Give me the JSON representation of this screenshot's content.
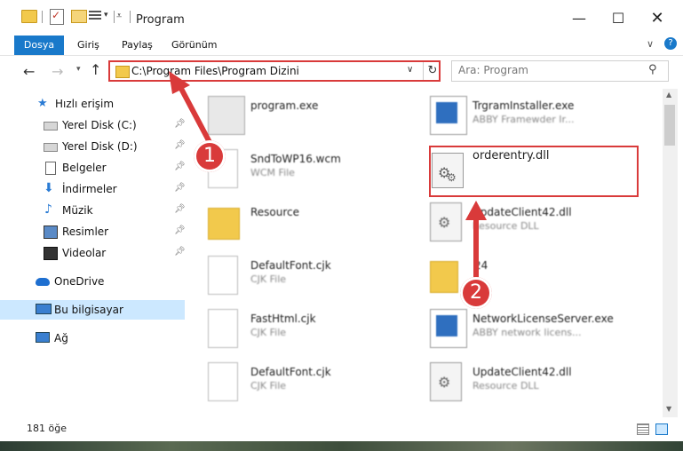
{
  "window": {
    "title": "Program"
  },
  "ribbon": {
    "tabs": [
      "Dosya",
      "Giriş",
      "Paylaş",
      "Görünüm"
    ]
  },
  "address": {
    "path": "C:\\Program Files\\Program Dizini",
    "search_placeholder": "Ara: Program"
  },
  "sidebar": {
    "items": [
      {
        "label": "Hızlı erişim",
        "icon": "star-icon"
      },
      {
        "label": "Yerel Disk (C:)",
        "icon": "drive-icon",
        "pinned": true
      },
      {
        "label": "Yerel Disk (D:)",
        "icon": "drive-icon",
        "pinned": true
      },
      {
        "label": "Belgeler",
        "icon": "document-icon",
        "pinned": true
      },
      {
        "label": "İndirmeler",
        "icon": "download-icon",
        "pinned": true
      },
      {
        "label": "Müzik",
        "icon": "music-icon",
        "pinned": true
      },
      {
        "label": "Resimler",
        "icon": "pictures-icon",
        "pinned": true
      },
      {
        "label": "Videolar",
        "icon": "video-icon",
        "pinned": true
      },
      {
        "label": "OneDrive",
        "icon": "cloud-icon"
      },
      {
        "label": "Bu bilgisayar",
        "icon": "computer-icon",
        "selected": true
      },
      {
        "label": "Ağ",
        "icon": "network-icon"
      }
    ]
  },
  "files": {
    "left": [
      {
        "name": "program.exe",
        "desc": ""
      },
      {
        "name": "SndToWP16.wcm",
        "desc": "WCM File"
      },
      {
        "name": "Resource",
        "desc": ""
      },
      {
        "name": "DefaultFont.cjk",
        "desc": "CJK File"
      },
      {
        "name": "FastHtml.cjk",
        "desc": "CJK File"
      },
      {
        "name": "DefaultFont.cjk",
        "desc": "CJK File"
      }
    ],
    "right": [
      {
        "name": "TrgramInstaller.exe",
        "desc": "ABBY Framewder Ir..."
      },
      {
        "name": "orderentry.dll",
        "desc": ""
      },
      {
        "name": "UpdateClient42.dll",
        "desc": "Resource DLL"
      },
      {
        "name": "24",
        "desc": ""
      },
      {
        "name": "NetworkLicenseServer.exe",
        "desc": "ABBY network licens..."
      },
      {
        "name": "UpdateClient42.dll",
        "desc": "Resource DLL"
      }
    ]
  },
  "status": {
    "count": "181 öğe"
  },
  "annotations": {
    "callout_1": "1",
    "callout_2": "2"
  },
  "colors": {
    "accent": "#1979ca",
    "highlight": "#d93a3a",
    "selected": "#cce8ff"
  }
}
